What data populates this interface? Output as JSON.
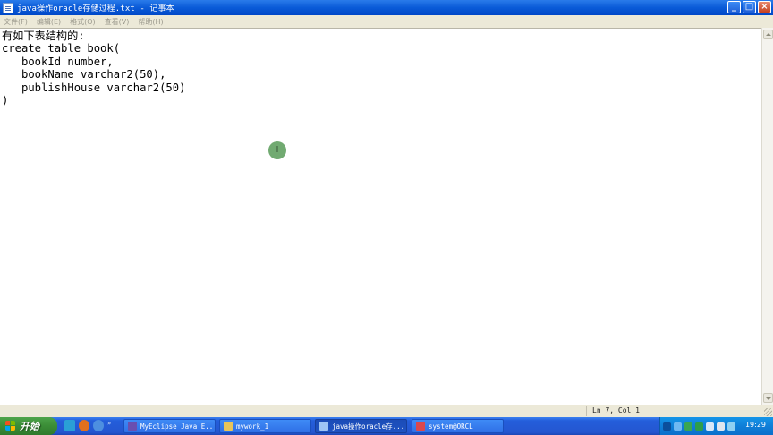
{
  "window": {
    "title": "java操作oracle存储过程.txt - 记事本",
    "buttons": {
      "minimize": "_",
      "maximize": "□",
      "close": "×"
    }
  },
  "menu": [
    "文件(F)",
    "编辑(E)",
    "格式(O)",
    "查看(V)",
    "帮助(H)"
  ],
  "editor": {
    "lines": [
      "有如下表结构的:",
      "create table book(",
      "   bookId number,",
      "   bookName varchar2(50),",
      "   publishHouse varchar2(50)",
      ")"
    ]
  },
  "status": {
    "position": "Ln 7, Col 1"
  },
  "cursor": {
    "glyph": "I"
  },
  "taskbar": {
    "start_label": "开始",
    "quick_launch_more": "»",
    "tasks": [
      {
        "label": "MyEclipse Java E...",
        "icon_color": "#6a4fb0"
      },
      {
        "label": "mywork_1",
        "icon_color": "#e8c55a"
      },
      {
        "label": "java操作oracle存...",
        "icon_color": "#9ec4f5"
      },
      {
        "label": "system@ORCL",
        "icon_color": "#d9484f"
      }
    ],
    "time": "19:29"
  },
  "colors": {
    "titlebar": "#0A5BD8",
    "taskbar": "#245EDB",
    "start": "#3C8F38",
    "tray": "#0F7FD8",
    "cursor_dot": "#6aa66a"
  }
}
